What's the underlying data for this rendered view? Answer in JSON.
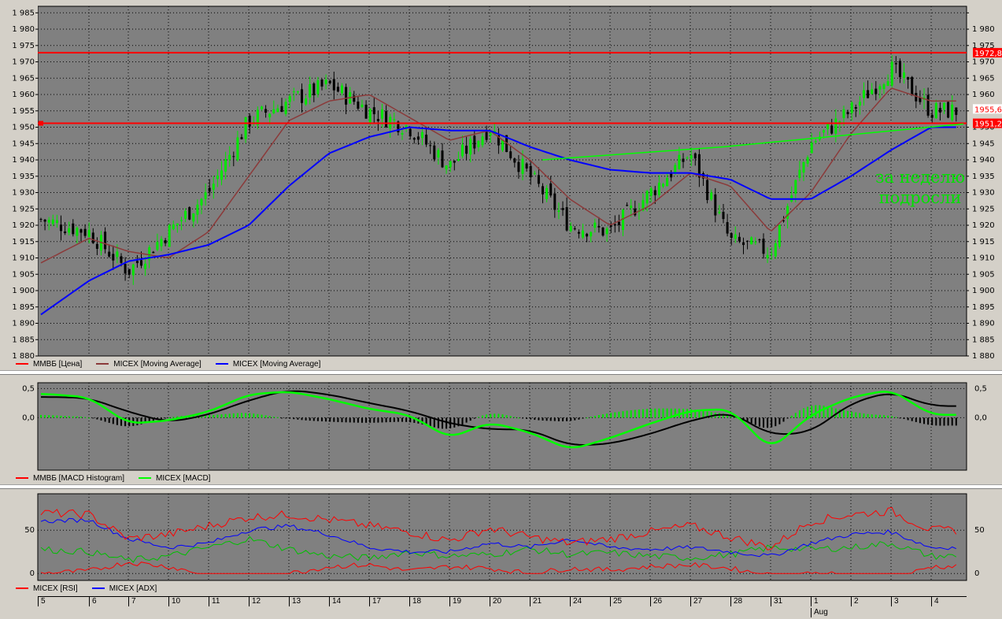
{
  "colors": {
    "panel_bg": "#808080",
    "up_candle": "#00e600",
    "down_candle": "#000000",
    "ma_short": "#8b3a3a",
    "ma_long": "#0000ff",
    "macd_line": "#00ff00",
    "signal_line": "#000000",
    "rsi": "#ff0000",
    "adx": "#0000ff",
    "other_line": "#00c000",
    "level_line": "#ff0000",
    "trendline": "#00ff00"
  },
  "price_panel": {
    "y_ticks": [
      "1 985",
      "1 980",
      "1 975",
      "1 970",
      "1 965",
      "1 960",
      "1 955",
      "1 950",
      "1 945",
      "1 940",
      "1 935",
      "1 930",
      "1 925",
      "1 920",
      "1 915",
      "1 910",
      "1 905",
      "1 900",
      "1 895",
      "1 890",
      "1 885",
      "1 880"
    ],
    "level_labels": {
      "upper": "1972,8",
      "current": "1955,6",
      "lower": "1951,2"
    },
    "legend": [
      "ММВБ [Цена]",
      "MICEX [Moving Average]",
      "MICEX [Moving Average]"
    ]
  },
  "macd_panel": {
    "y_ticks": [
      "0,5",
      "0,0"
    ],
    "legend": [
      "ММВБ [MACD Histogram]",
      "MICEX [MACD]"
    ]
  },
  "rsi_panel": {
    "y_ticks": [
      "50",
      "0"
    ],
    "legend": [
      "MICEX [RSI]",
      "MICEX [ADX]"
    ]
  },
  "time_axis": {
    "days": [
      "5",
      "6",
      "7",
      "10",
      "11",
      "12",
      "13",
      "14",
      "17",
      "18",
      "19",
      "20",
      "21",
      "24",
      "25",
      "26",
      "27",
      "28",
      "31",
      "1",
      "2",
      "3",
      "4"
    ],
    "month_label": "Aug"
  },
  "annotation": {
    "line1": "за неделю",
    "line2": "подросли"
  },
  "chart_data": [
    {
      "type": "candlestick",
      "x": [
        "5",
        "6",
        "7",
        "10",
        "11",
        "12",
        "13",
        "14",
        "17",
        "18",
        "19",
        "20",
        "21",
        "24",
        "25",
        "26",
        "27",
        "28",
        "31",
        "1",
        "2",
        "3",
        "4"
      ],
      "close_by_day": [
        1922,
        1918,
        1906,
        1918,
        1930,
        1952,
        1958,
        1963,
        1955,
        1950,
        1938,
        1950,
        1935,
        1920,
        1918,
        1930,
        1942,
        1915,
        1912,
        1945,
        1955,
        1968,
        1955
      ],
      "ma_short_by_day": [
        1908,
        1916,
        1912,
        1910,
        1918,
        1935,
        1952,
        1958,
        1960,
        1953,
        1946,
        1949,
        1940,
        1928,
        1920,
        1926,
        1936,
        1932,
        1918,
        1930,
        1948,
        1962,
        1958
      ],
      "ma_long_by_day": [
        1892,
        1903,
        1909,
        1911,
        1914,
        1920,
        1932,
        1942,
        1947,
        1950,
        1949,
        1949,
        1944,
        1940,
        1937,
        1936,
        1936,
        1934,
        1928,
        1928,
        1935,
        1943,
        1950
      ],
      "levels": [
        1972.8,
        1951.2
      ],
      "current": 1955.6,
      "trendline": [
        [
          21,
          1940
        ],
        [
          28,
          1944
        ],
        [
          4.9,
          1951
        ]
      ],
      "ylim": [
        1880,
        1987
      ]
    },
    {
      "type": "line",
      "name": "MACD",
      "x": [
        "5",
        "6",
        "7",
        "10",
        "11",
        "12",
        "13",
        "14",
        "17",
        "18",
        "19",
        "20",
        "21",
        "24",
        "25",
        "26",
        "27",
        "28",
        "31",
        "1",
        "2",
        "3",
        "4"
      ],
      "macd_by_day": [
        0.42,
        0.35,
        -0.1,
        -0.05,
        0.1,
        0.4,
        0.45,
        0.32,
        0.15,
        0.05,
        -0.35,
        -0.08,
        -0.25,
        -0.55,
        -0.35,
        -0.1,
        0.12,
        0.15,
        -0.55,
        0.05,
        0.35,
        0.48,
        0.05
      ],
      "signal_by_day": [
        0.36,
        0.34,
        0.1,
        -0.08,
        0.05,
        0.3,
        0.48,
        0.4,
        0.25,
        0.12,
        -0.1,
        -0.2,
        -0.2,
        -0.48,
        -0.45,
        -0.28,
        -0.05,
        0.1,
        -0.3,
        -0.25,
        0.25,
        0.45,
        0.2
      ],
      "ylim": [
        -0.9,
        0.6
      ]
    },
    {
      "type": "line",
      "name": "RSI/ADX",
      "x": [
        "5",
        "6",
        "7",
        "10",
        "11",
        "12",
        "13",
        "14",
        "17",
        "18",
        "19",
        "20",
        "21",
        "24",
        "25",
        "26",
        "27",
        "28",
        "31",
        "1",
        "2",
        "3",
        "4"
      ],
      "rsi_by_day": [
        70,
        68,
        40,
        45,
        55,
        65,
        68,
        62,
        55,
        48,
        38,
        52,
        42,
        35,
        40,
        48,
        55,
        42,
        30,
        60,
        68,
        72,
        50
      ],
      "adx_by_day": [
        60,
        62,
        40,
        30,
        35,
        50,
        55,
        45,
        30,
        25,
        25,
        35,
        30,
        40,
        30,
        28,
        30,
        25,
        20,
        35,
        45,
        48,
        30
      ],
      "other_by_day": [
        28,
        25,
        15,
        20,
        30,
        40,
        28,
        20,
        18,
        25,
        20,
        22,
        28,
        22,
        24,
        20,
        18,
        22,
        30,
        28,
        30,
        35,
        20
      ],
      "ylim": [
        -8,
        92
      ]
    }
  ]
}
